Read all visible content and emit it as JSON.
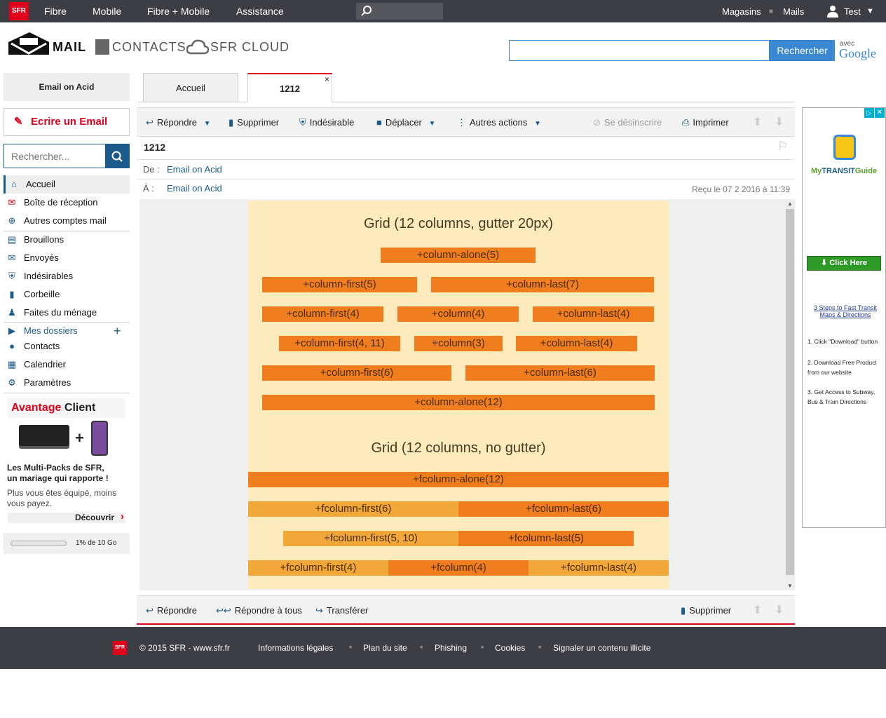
{
  "topbar": {
    "logo": "SFR",
    "nav": [
      "Fibre",
      "Mobile",
      "Fibre + Mobile",
      "Assistance"
    ],
    "right": {
      "stores": "Magasins",
      "mails": "Mails",
      "user": "Test"
    }
  },
  "brand": {
    "mail": "MAIL",
    "contacts": "CONTACTS",
    "cloud": "SFR CLOUD",
    "search_button": "Rechercher",
    "avec": "avec",
    "google": "Google"
  },
  "sidebar": {
    "email_on_acid": "Email on Acid",
    "compose": "Ecrire un Email",
    "search_placeholder": "Rechercher...",
    "items": [
      {
        "label": "Accueil",
        "icon": "home-icon"
      },
      {
        "label": "Boîte de réception",
        "icon": "inbox-icon"
      },
      {
        "label": "Autres comptes mail",
        "icon": "plus-circle-icon"
      },
      {
        "label": "Brouillons",
        "icon": "draft-icon"
      },
      {
        "label": "Envoyés",
        "icon": "sent-icon"
      },
      {
        "label": "Indésirables",
        "icon": "shield-icon"
      },
      {
        "label": "Corbeille",
        "icon": "trash-icon"
      },
      {
        "label": "Faites du ménage",
        "icon": "broom-icon"
      },
      {
        "label": "Mes dossiers",
        "icon": "folder-arrow-icon"
      },
      {
        "label": "Contacts",
        "icon": "contacts-icon"
      },
      {
        "label": "Calendrier",
        "icon": "calendar-icon"
      },
      {
        "label": "Paramètres",
        "icon": "gear-icon"
      }
    ],
    "promo": {
      "title_red": "Avantage",
      "title_black": "Client",
      "headline1": "Les Multi-Packs de SFR,",
      "headline2": "un mariage qui rapporte !",
      "body1": "Plus vous êtes équipé, moins",
      "body2": "vous payez.",
      "link": "Découvrir"
    },
    "storage": "1% de 10 Go"
  },
  "tabs": [
    {
      "label": "Accueil"
    },
    {
      "label": "1212",
      "close": "×"
    }
  ],
  "toolbar": {
    "reply": "Répondre",
    "delete": "Supprimer",
    "spam": "Indésirable",
    "move": "Déplacer",
    "more": "Autres actions",
    "unsubscribe": "Se désinscrire",
    "print": "Imprimer"
  },
  "message": {
    "subject": "1212",
    "from_label": "De :",
    "from": "Email on Acid",
    "to_label": "À :",
    "to": "Email on Acid",
    "received": "Reçu le 07 2 2016 à 11:39"
  },
  "email_body": {
    "heading1": "Grid (12 columns, gutter 20px)",
    "heading2": "Grid (12 columns, no gutter)",
    "rows_gutter": [
      [
        "+column-alone(5)"
      ],
      [
        "+column-first(5)",
        "+column-last(7)"
      ],
      [
        "+column-first(4)",
        "+column(4)",
        "+column-last(4)"
      ],
      [
        "+column-first(4, 11)",
        "+column(3)",
        "+column-last(4)"
      ],
      [
        "+column-first(6)",
        "+column-last(6)"
      ],
      [
        "+column-alone(12)"
      ]
    ],
    "rows_nogutter": [
      [
        "+fcolumn-alone(12)"
      ],
      [
        "+fcolumn-first(6)",
        "+fcolumn-last(6)"
      ],
      [
        "+fcolumn-first(5, 10)",
        "+fcolumn-last(5)"
      ],
      [
        "+fcolumn-first(4)",
        "+fcolumn(4)",
        "+fcolumn-last(4)"
      ]
    ]
  },
  "bottom_toolbar": {
    "reply": "Répondre",
    "reply_all": "Répondre à tous",
    "forward": "Transférer",
    "delete": "Supprimer"
  },
  "ad": {
    "brand_my": "My",
    "brand_transit": "TRANSIT",
    "brand_guide": "Guide",
    "cta": "Click Here",
    "steps_title": "3 Steps to Fast Transit Maps & Directions",
    "step1": "1. Click \"Download\" button",
    "step2": "2. Download Free Product from our website",
    "step3": "3. Get Access to Subway, Bus & Train Directions"
  },
  "footer": {
    "logo": "SFR",
    "copyright": "© 2015 SFR - www.sfr.fr",
    "links": [
      "Informations légales",
      "Plan du site",
      "Phishing",
      "Cookies",
      "Signaler un contenu illicite"
    ]
  },
  "colors": {
    "accent": "#e2001a",
    "blue": "#3a87d4",
    "orange": "#f07d1e",
    "light_orange": "#f2a838",
    "email_bg": "#fdebbd"
  }
}
